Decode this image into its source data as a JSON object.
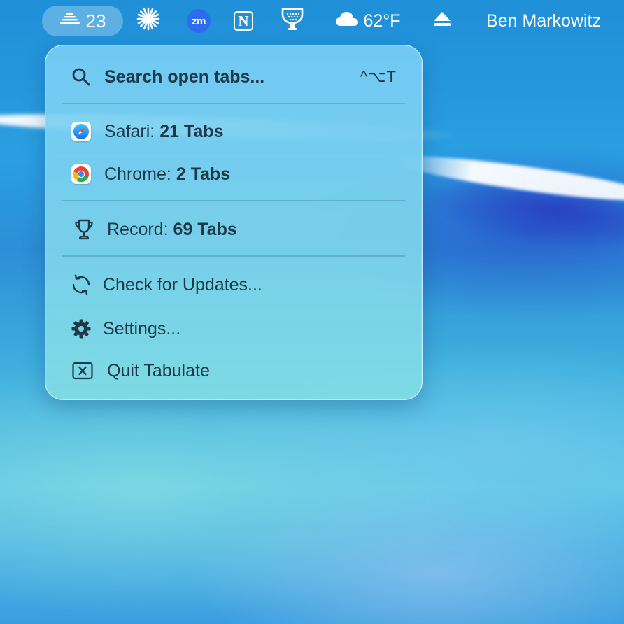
{
  "menubar": {
    "tabulate_count": "23",
    "weather_temp": "62°F",
    "user_name": "Ben Markowitz",
    "zoom_label": "zm",
    "notion_label": "N",
    "icons": [
      "tabulate-stack-icon",
      "burst-icon",
      "zoom-icon",
      "notion-icon",
      "cup-icon",
      "cloud-icon",
      "eject-icon"
    ]
  },
  "menu": {
    "search": {
      "label": "Search open tabs...",
      "shortcut": "^⌥T",
      "icon": "search-icon"
    },
    "browsers": [
      {
        "name": "Safari:",
        "count": "21 Tabs",
        "icon": "safari-icon"
      },
      {
        "name": "Chrome:",
        "count": "2 Tabs",
        "icon": "chrome-icon"
      }
    ],
    "record": {
      "name": "Record:",
      "count": "69 Tabs",
      "icon": "trophy-icon"
    },
    "actions": [
      {
        "label": "Check for Updates...",
        "icon": "refresh-icon"
      },
      {
        "label": "Settings...",
        "icon": "gear-icon"
      },
      {
        "label": "Quit Tabulate",
        "icon": "close-box-icon"
      }
    ]
  },
  "colors": {
    "menu_text": "#1e3a48",
    "zoom_blue": "#2d6bf0",
    "panel_bg": "#7cd0ee"
  }
}
